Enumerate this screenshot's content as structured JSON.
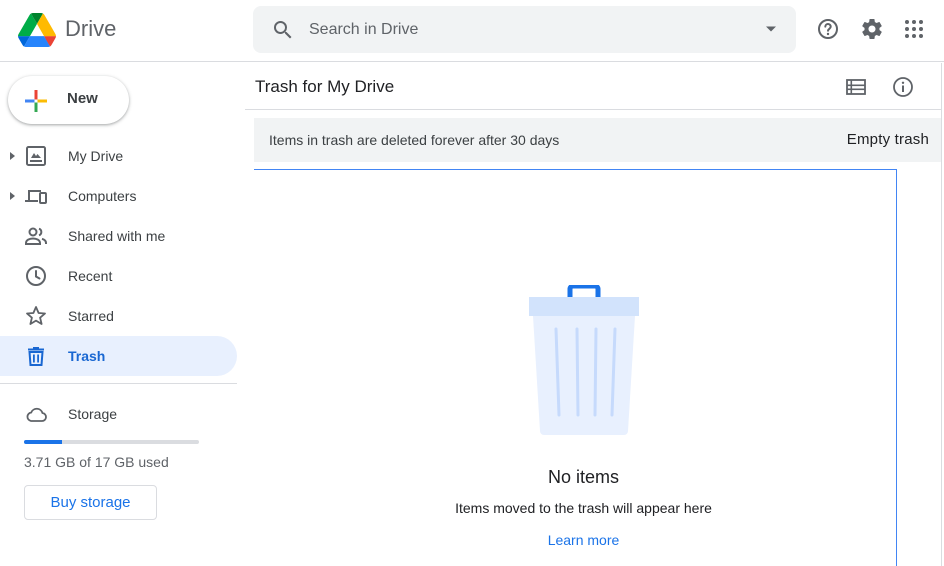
{
  "header": {
    "brand": "Drive",
    "search_placeholder": "Search in Drive"
  },
  "sidebar": {
    "new_label": "New",
    "items": [
      {
        "label": "My Drive",
        "icon": "my-drive-icon",
        "expandable": true
      },
      {
        "label": "Computers",
        "icon": "computers-icon",
        "expandable": true
      },
      {
        "label": "Shared with me",
        "icon": "people-icon",
        "expandable": false
      },
      {
        "label": "Recent",
        "icon": "clock-icon",
        "expandable": false
      },
      {
        "label": "Starred",
        "icon": "star-icon",
        "expandable": false
      },
      {
        "label": "Trash",
        "icon": "trash-icon",
        "expandable": false,
        "active": true
      }
    ],
    "storage": {
      "title": "Storage",
      "used_text": "3.71 GB of 17 GB used",
      "used_fraction": 0.218,
      "buy_label": "Buy storage"
    }
  },
  "main": {
    "title": "Trash for My Drive",
    "banner_message": "Items in trash are deleted forever after 30 days",
    "empty_trash_label": "Empty trash",
    "empty_state": {
      "title": "No items",
      "subtitle": "Items moved to the trash will appear here",
      "link": "Learn more"
    }
  },
  "colors": {
    "accent": "#1a73e8",
    "active_bg": "#e8f0fe",
    "active_text": "#1967d2"
  }
}
